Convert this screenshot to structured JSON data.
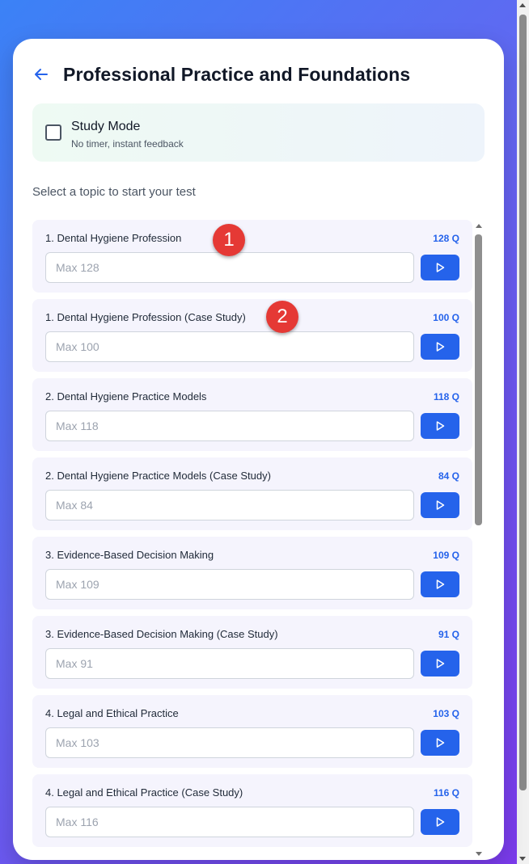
{
  "header": {
    "title": "Professional Practice and Foundations"
  },
  "study_mode": {
    "title": "Study Mode",
    "subtitle": "No timer, instant feedback",
    "checked": false
  },
  "select_label": "Select a topic to start your test",
  "topics": [
    {
      "name": "1. Dental Hygiene Profession",
      "count": "128 Q",
      "placeholder": "Max 128"
    },
    {
      "name": "1. Dental Hygiene Profession (Case Study)",
      "count": "100 Q",
      "placeholder": "Max 100"
    },
    {
      "name": "2. Dental Hygiene Practice Models",
      "count": "118 Q",
      "placeholder": "Max 118"
    },
    {
      "name": "2. Dental Hygiene Practice Models (Case Study)",
      "count": "84 Q",
      "placeholder": "Max 84"
    },
    {
      "name": "3. Evidence-Based Decision Making",
      "count": "109 Q",
      "placeholder": "Max 109"
    },
    {
      "name": "3. Evidence-Based Decision Making (Case Study)",
      "count": "91 Q",
      "placeholder": "Max 91"
    },
    {
      "name": "4. Legal and Ethical Practice",
      "count": "103 Q",
      "placeholder": "Max 103"
    },
    {
      "name": "4. Legal and Ethical Practice (Case Study)",
      "count": "116 Q",
      "placeholder": "Max 116"
    }
  ],
  "markers": [
    "1",
    "2"
  ],
  "icons": {
    "back": "arrow-left-icon",
    "play": "play-icon"
  },
  "colors": {
    "accent": "#2563eb",
    "marker": "#e53935",
    "topic_bg": "#f5f4fd"
  }
}
